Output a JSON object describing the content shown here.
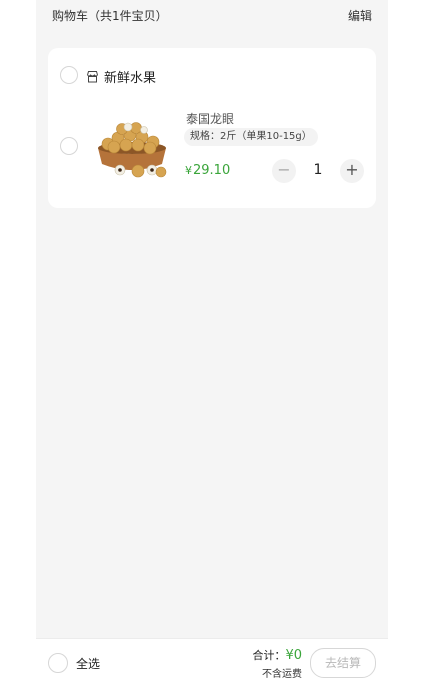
{
  "header": {
    "title": "购物车（共1件宝贝）",
    "edit": "编辑"
  },
  "shop": {
    "name": "新鲜水果",
    "icon": "store-icon"
  },
  "item": {
    "name": "泰国龙眼",
    "spec": "规格：2斤（单果10-15g）",
    "currency": "¥",
    "price": "29.10",
    "quantity": "1",
    "minus_label": "−",
    "plus_label": "+",
    "image": "longan-fruit-bowl"
  },
  "footer": {
    "select_all": "全选",
    "total_label": "合计：",
    "total_value": "¥0",
    "shipping_note": "不含运费",
    "checkout": "去结算"
  },
  "colors": {
    "accent_green": "#3aa53a",
    "page_bg": "#f5f5f5"
  }
}
